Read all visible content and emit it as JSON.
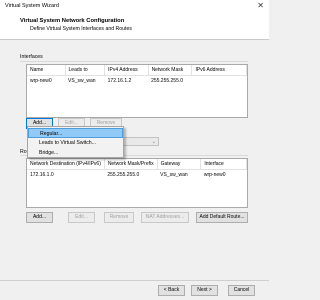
{
  "window": {
    "title": "Virtual System Wizard",
    "close_glyph": "✕"
  },
  "header": {
    "title": "Virtual System Network Configuration",
    "subtitle": "Define Virtual System Interfaces and Routes"
  },
  "interfaces": {
    "group_label": "Interfaces",
    "columns": [
      "Name",
      "Leads to",
      "IPv4 Address",
      "Network Mask",
      "IPv6 Address"
    ],
    "rows": [
      [
        "wrp-new0",
        "VS_sw_wan",
        "172.16.1.2",
        "255.255.255.0",
        ""
      ]
    ],
    "buttons": {
      "add": "Add...",
      "edit": "Edit...",
      "remove": "Remove"
    }
  },
  "add_menu": {
    "items": [
      "Regular...",
      "Leads to Virtual Switch...",
      "Bridge..."
    ],
    "highlighted_index": 0
  },
  "routes": {
    "group_label": "Ro",
    "columns": [
      "Network Destination (IPv4/IPv6)",
      "Network Mask/Prefix",
      "Gateway",
      "Interface"
    ],
    "rows": [
      [
        "172.16.1.0",
        "255.255.255.0",
        "VS_sw_wan",
        "wrp-new0"
      ]
    ],
    "buttons": {
      "add": "Add...",
      "edit": "Edit...",
      "remove": "Remove",
      "nat": "NAT Addresses...",
      "default_route": "Add Default Route..."
    }
  },
  "footer": {
    "back": "< Back",
    "next": "Next >",
    "cancel": "Cancel"
  }
}
